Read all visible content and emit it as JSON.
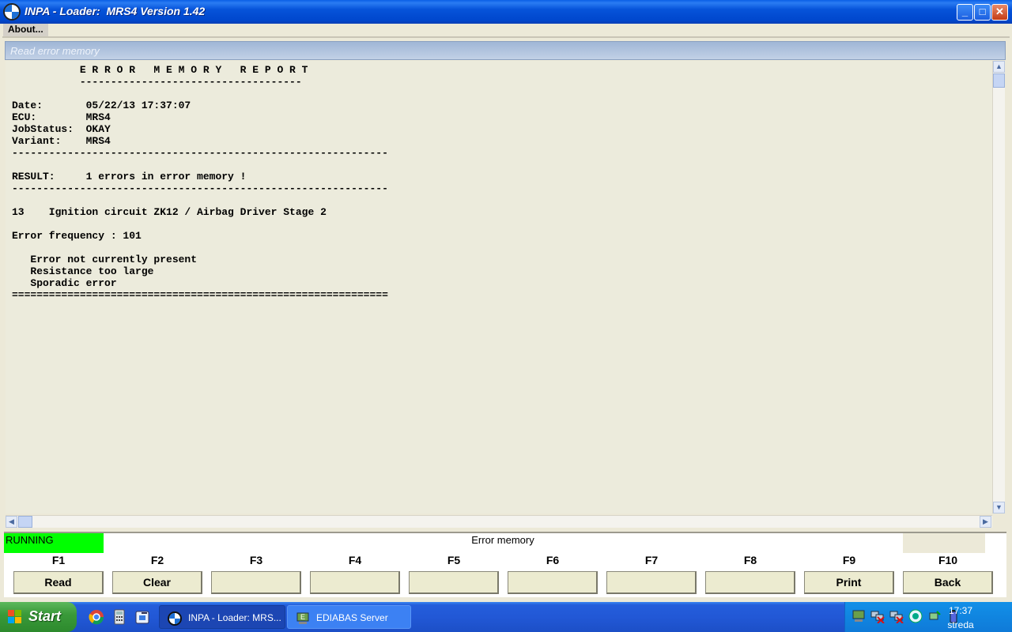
{
  "window": {
    "title": "INPA - Loader:  MRS4 Version 1.42",
    "min_glyph": "_",
    "max_glyph": "□",
    "close_glyph": "✕"
  },
  "menu": {
    "about": "About..."
  },
  "panel": {
    "title": "Read error memory"
  },
  "report": {
    "lines": [
      "           E R R O R   M E M O R Y   R E P O R T",
      "           ------------------------------------",
      "",
      "Date:       05/22/13 17:37:07",
      "ECU:        MRS4",
      "JobStatus:  OKAY",
      "Variant:    MRS4",
      "-------------------------------------------------------------",
      "",
      "RESULT:     1 errors in error memory !",
      "-------------------------------------------------------------",
      "",
      "13    Ignition circuit ZK12 / Airbag Driver Stage 2",
      "",
      "Error frequency : 101",
      "",
      "   Error not currently present",
      "   Resistance too large",
      "   Sporadic error",
      "============================================================="
    ]
  },
  "scroll": {
    "up": "▲",
    "down": "▼",
    "left": "◀",
    "right": "▶"
  },
  "status": {
    "state": "RUNNING",
    "title": "Error memory",
    "state_color": "#00ff00"
  },
  "fkeys": [
    {
      "key": "F1",
      "label": "Read"
    },
    {
      "key": "F2",
      "label": "Clear"
    },
    {
      "key": "F3",
      "label": ""
    },
    {
      "key": "F4",
      "label": ""
    },
    {
      "key": "F5",
      "label": ""
    },
    {
      "key": "F6",
      "label": ""
    },
    {
      "key": "F7",
      "label": ""
    },
    {
      "key": "F8",
      "label": ""
    },
    {
      "key": "F9",
      "label": "Print"
    },
    {
      "key": "F10",
      "label": "Back"
    }
  ],
  "taskbar": {
    "start": "Start",
    "quicklaunch": [
      "chrome-icon",
      "calculator-icon",
      "explorer-icon"
    ],
    "tasks": [
      {
        "label": "INPA - Loader:  MRS...",
        "icon": "bmw-icon",
        "active": true
      },
      {
        "label": "EDIABAS Server",
        "icon": "ediabas-icon",
        "active": false
      }
    ],
    "tray_icons": [
      "ediabas-tray-icon",
      "network-disconnected-icon",
      "network-disconnected-icon",
      "antivirus-icon",
      "safely-remove-icon",
      "battery-icon"
    ],
    "clock": {
      "time": "17:37",
      "day": "streda"
    }
  }
}
